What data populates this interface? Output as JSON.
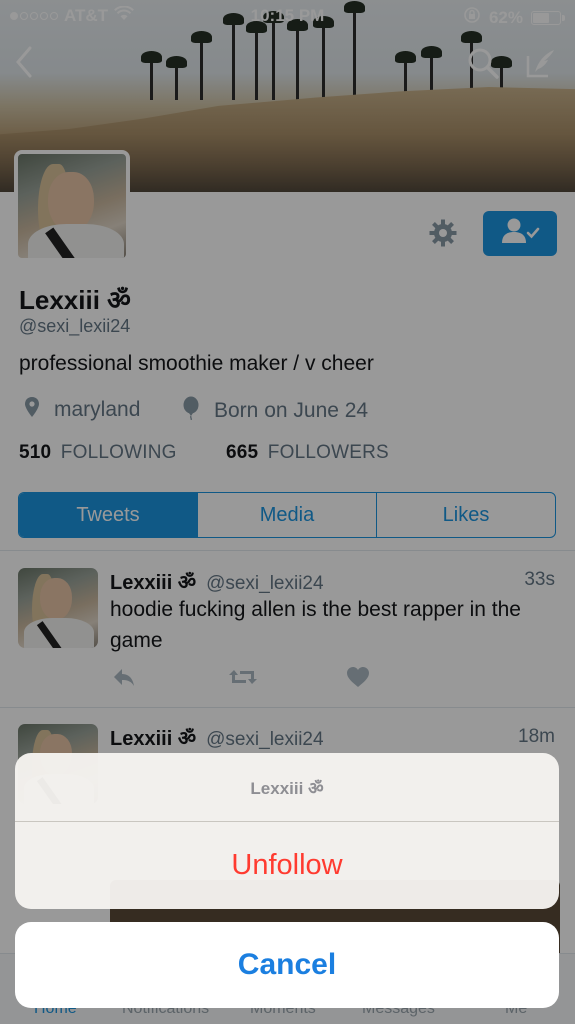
{
  "status_bar": {
    "carrier": "AT&T",
    "time": "10:15 PM",
    "battery": "62%",
    "battery_level": 0.62
  },
  "profile": {
    "name": "Lexxiii ॐ",
    "handle": "@sexi_lexii24",
    "bio": "professional smoothie maker / v cheer",
    "location": "maryland",
    "birthday": "Born on June 24",
    "following_count": "510",
    "following_label": "FOLLOWING",
    "followers_count": "665",
    "followers_label": "FOLLOWERS"
  },
  "tabs": [
    {
      "label": "Tweets",
      "active": true
    },
    {
      "label": "Media",
      "active": false
    },
    {
      "label": "Likes",
      "active": false
    }
  ],
  "tweets": [
    {
      "name": "Lexxiii ॐ",
      "handle": "@sexi_lexii24",
      "time": "33s",
      "text": "hoodie fucking allen is the best rapper in the game"
    },
    {
      "name": "Lexxiii ॐ",
      "handle": "@sexi_lexii24",
      "time": "18m",
      "text": ""
    }
  ],
  "tab_bar": {
    "items": [
      "Home",
      "Notifications",
      "Moments",
      "Messages",
      "Me"
    ]
  },
  "action_sheet": {
    "title": "Lexxiii ॐ",
    "action": "Unfollow",
    "cancel": "Cancel"
  },
  "colors": {
    "accent": "#1b95e0",
    "destructive": "#ff3b30",
    "secondary_text": "#657786"
  }
}
